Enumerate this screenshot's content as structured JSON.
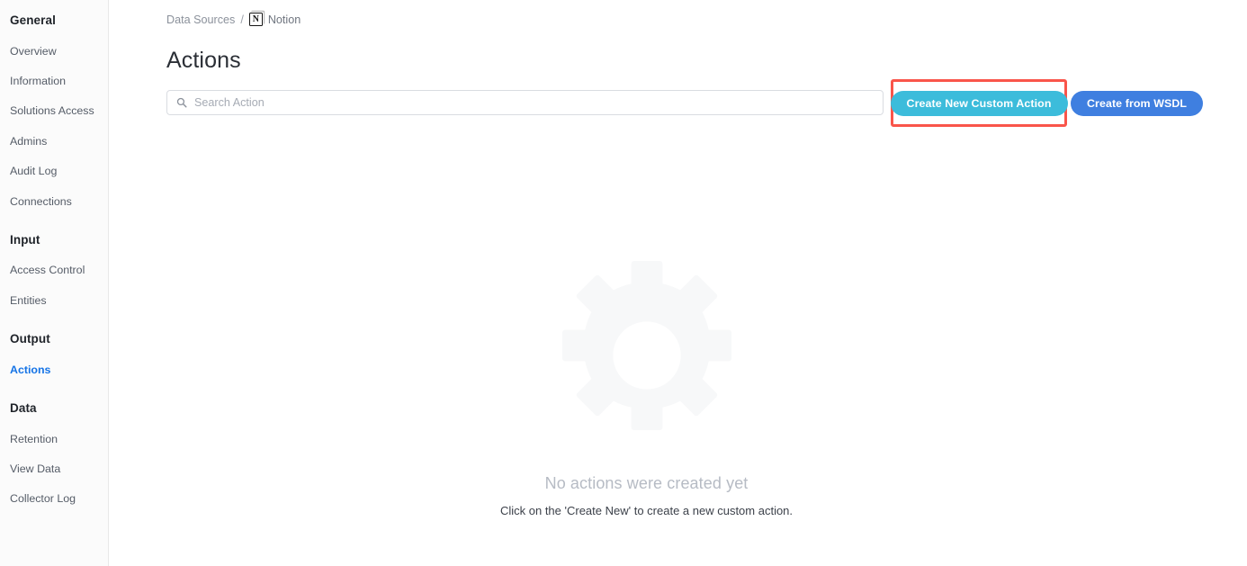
{
  "sidebar": {
    "groups": [
      {
        "title": "General",
        "items": [
          {
            "label": "Overview",
            "active": false
          },
          {
            "label": "Information",
            "active": false
          },
          {
            "label": "Solutions Access",
            "active": false
          },
          {
            "label": "Admins",
            "active": false
          },
          {
            "label": "Audit Log",
            "active": false
          },
          {
            "label": "Connections",
            "active": false
          }
        ]
      },
      {
        "title": "Input",
        "items": [
          {
            "label": "Access Control",
            "active": false
          },
          {
            "label": "Entities",
            "active": false
          }
        ]
      },
      {
        "title": "Output",
        "items": [
          {
            "label": "Actions",
            "active": true
          }
        ]
      },
      {
        "title": "Data",
        "items": [
          {
            "label": "Retention",
            "active": false
          },
          {
            "label": "View Data",
            "active": false
          },
          {
            "label": "Collector Log",
            "active": false
          }
        ]
      }
    ]
  },
  "breadcrumb": {
    "root": "Data Sources",
    "separator": "/",
    "current": "Notion",
    "current_icon": "notion-logo-icon",
    "current_icon_glyph": "N"
  },
  "header": {
    "title": "Actions"
  },
  "search": {
    "placeholder": "Search Action",
    "value": "",
    "icon": "search-icon"
  },
  "toolbar": {
    "create_custom_label": "Create New Custom Action",
    "create_wsdl_label": "Create from WSDL",
    "highlight_color": "#f9554a",
    "create_custom_color": "#3cbcdb",
    "create_wsdl_color": "#3f7fe0"
  },
  "empty_state": {
    "illustration": "gear-icon",
    "title": "No actions were created yet",
    "subtitle": "Click on the 'Create New' to create a new custom action."
  },
  "colors": {
    "accent_blue": "#1473e6",
    "sidebar_bg": "#fbfbfb",
    "page_bg": "#ffffff",
    "muted_text": "#8b919b"
  }
}
